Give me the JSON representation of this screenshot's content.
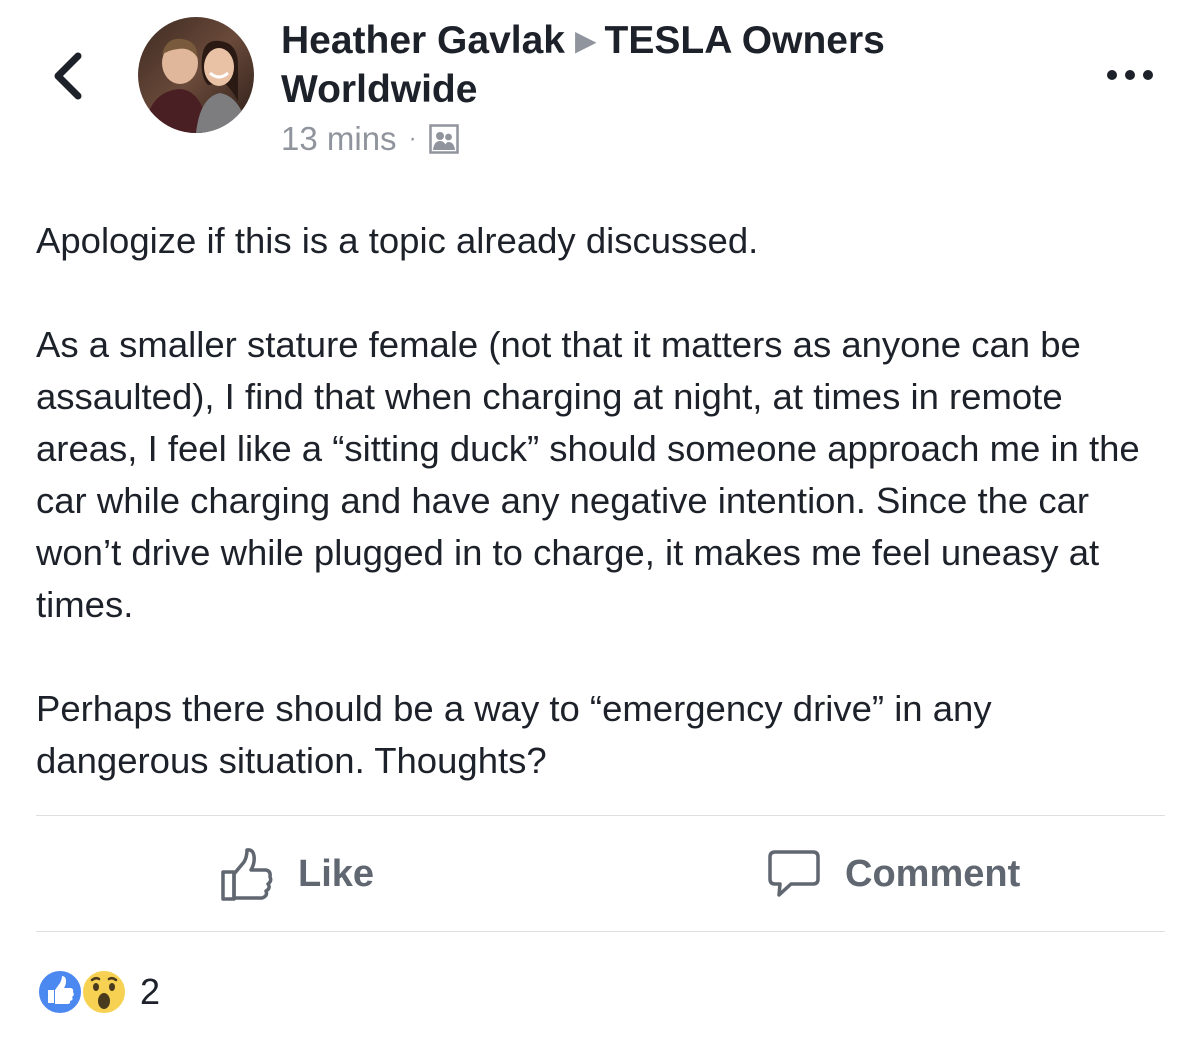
{
  "post": {
    "author": "Heather Gavlak",
    "group": "TESLA Owners Worldwide",
    "timestamp": "13 mins",
    "audience_icon": "group-members-icon",
    "paragraphs": [
      "Apologize if this is a topic already discussed.",
      "As a smaller stature female (not that it matters as anyone can be assaulted), I find that when charging at night, at times in remote areas, I feel like a “sitting duck” should someone approach me in the car while charging and have any negative intention. Since the car won’t drive while plugged in to charge, it makes me feel uneasy at times.",
      "Perhaps there should be a way to “emergency drive” in any dangerous situation. Thoughts?"
    ]
  },
  "actions": {
    "like_label": "Like",
    "comment_label": "Comment"
  },
  "reactions": {
    "types": [
      "like",
      "wow"
    ],
    "count": "2"
  },
  "colors": {
    "text": "#1d2129",
    "secondary": "#90949c",
    "action": "#606770",
    "like_blue": "#4b88f0",
    "wow_yellow": "#f7d252",
    "divider": "#dddfe2"
  },
  "icons": {
    "back": "chevron-left-icon",
    "more": "more-horizontal-icon",
    "like": "thumbs-up-icon",
    "comment": "comment-bubble-icon"
  }
}
